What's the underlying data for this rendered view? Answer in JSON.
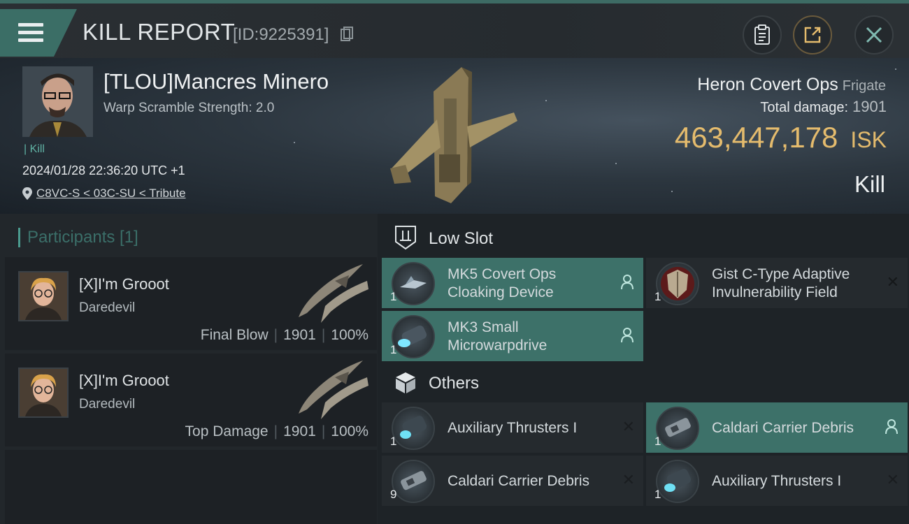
{
  "header": {
    "title": "KILL REPORT",
    "report_id": "[ID:9225391]"
  },
  "victim": {
    "pilot_name": "[TLOU]Mancres Minero",
    "warp_scramble": "Warp Scramble Strength: 2.0",
    "kill_label_small": "| Kill",
    "datetime": "2024/01/28 22:36:20 UTC +1",
    "location": "C8VC-S < 03C-SU < Tribute",
    "ship_name": "Heron Covert Ops",
    "ship_class": "Frigate",
    "total_damage_label": "Total damage:",
    "total_damage_value": "1901",
    "isk_value": "463,447,178",
    "isk_unit": "ISK",
    "result": "Kill"
  },
  "participants": {
    "title": "Participants [1]",
    "list": [
      {
        "name": "[X]I'm Grooot",
        "ship": "Daredevil",
        "tag": "Final Blow",
        "damage": "1901",
        "percent": "100%"
      },
      {
        "name": "[X]I'm Grooot",
        "ship": "Daredevil",
        "tag": "Top Damage",
        "damage": "1901",
        "percent": "100%"
      }
    ]
  },
  "sections": {
    "low_slot_title": "Low Slot",
    "others_title": "Others",
    "low_slot": [
      {
        "line1": "MK5 Covert Ops",
        "line2": "Cloaking Device",
        "qty": "1",
        "status": "dropped"
      },
      {
        "line1": "Gist C-Type Adaptive",
        "line2": "Invulnerability Field",
        "qty": "1",
        "status": "destroyed"
      },
      {
        "line1": "MK3 Small",
        "line2": "Microwarpdrive",
        "qty": "1",
        "status": "dropped"
      }
    ],
    "others": [
      {
        "line1": "Auxiliary Thrusters I",
        "qty": "1",
        "status": "destroyed"
      },
      {
        "line1": "Caldari Carrier Debris",
        "qty": "1",
        "status": "dropped"
      },
      {
        "line1": "Caldari Carrier Debris",
        "qty": "9",
        "status": "destroyed"
      },
      {
        "line1": "Auxiliary Thrusters I",
        "qty": "1",
        "status": "destroyed"
      }
    ],
    "destroyed_mark": "✕"
  },
  "colors": {
    "accent": "#3d7169",
    "isk_gold": "#e4bb6d"
  }
}
